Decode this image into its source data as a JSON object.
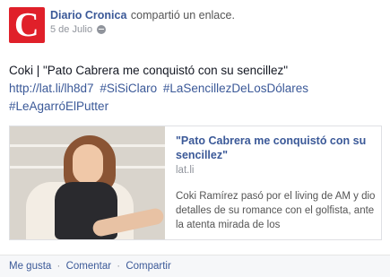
{
  "post": {
    "author": "Diario Cronica",
    "action": "compartió un enlace.",
    "date": "5 de Julio",
    "privacy_icon": "globe-icon",
    "message_text": "Coki | \"Pato Cabrera me conquistó con su sencillez\"",
    "link_url": "http://lat.li/lh8d7",
    "hashtags": [
      "#SiSiClaro",
      "#LaSencillezDeLosDólares",
      "#LeAgarróElPutter"
    ]
  },
  "link_card": {
    "title": "\"Pato Cabrera me conquistó con su sencillez\"",
    "domain": "lat.li",
    "description": "Coki Ramírez pasó por el living de AM y dio detalles de su romance con el golfista, ante la atenta mirada de los"
  },
  "actions": {
    "like": "Me gusta",
    "comment": "Comentar",
    "share": "Compartir",
    "separator": "·"
  },
  "colors": {
    "link_blue": "#3b5998",
    "brand_red": "#e0202a"
  }
}
